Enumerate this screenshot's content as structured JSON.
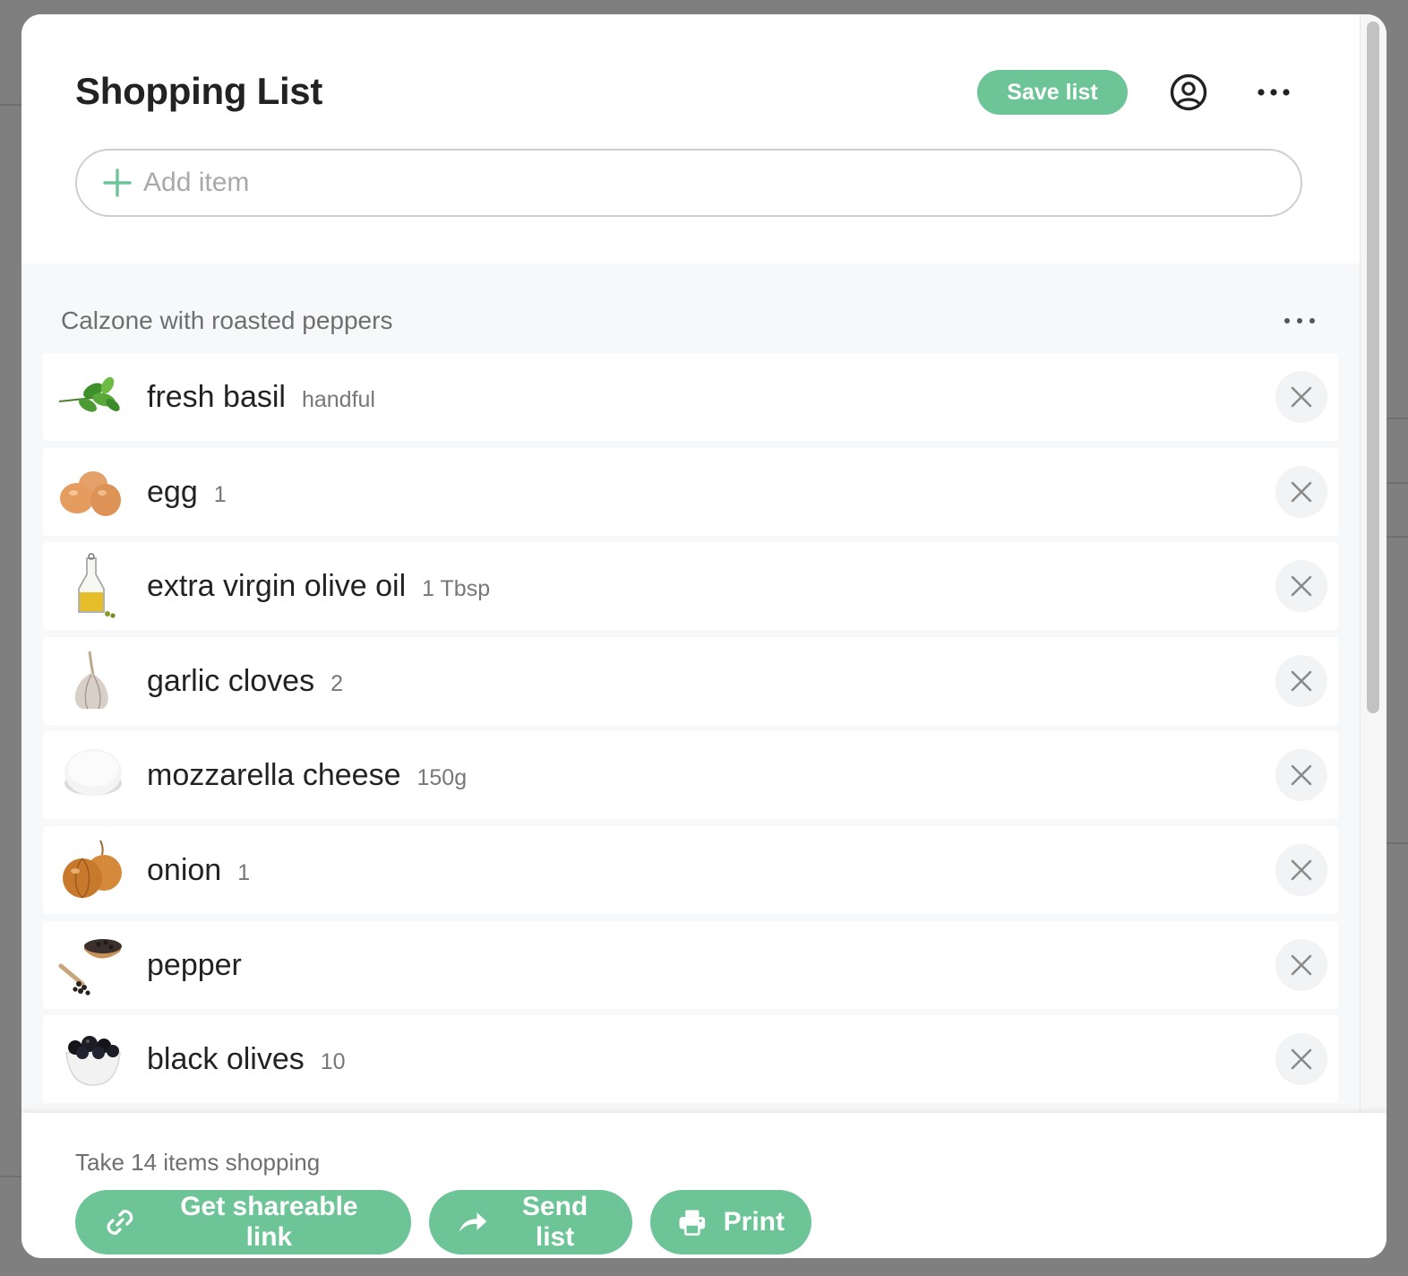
{
  "header": {
    "title": "Shopping List",
    "save_label": "Save list",
    "account_icon": "account-circle-icon",
    "more_icon": "more-horizontal-icon"
  },
  "add_item": {
    "placeholder": "Add item",
    "icon": "plus-icon"
  },
  "section": {
    "title": "Calzone with roasted peppers",
    "more_icon": "more-horizontal-icon"
  },
  "items": [
    {
      "name": "fresh basil",
      "qty": "handful",
      "icon": "basil-icon"
    },
    {
      "name": "egg",
      "qty": "1",
      "icon": "egg-icon"
    },
    {
      "name": "extra virgin olive oil",
      "qty": "1 Tbsp",
      "icon": "olive-oil-icon"
    },
    {
      "name": "garlic cloves",
      "qty": "2",
      "icon": "garlic-icon"
    },
    {
      "name": "mozzarella cheese",
      "qty": "150g",
      "icon": "mozzarella-icon"
    },
    {
      "name": "onion",
      "qty": "1",
      "icon": "onion-icon"
    },
    {
      "name": "pepper",
      "qty": "",
      "icon": "peppercorn-icon"
    },
    {
      "name": "black olives",
      "qty": "10",
      "icon": "black-olives-icon"
    }
  ],
  "footer": {
    "summary": "Take 14 items shopping",
    "share_label": "Get shareable link",
    "send_label": "Send list",
    "print_label": "Print"
  },
  "colors": {
    "accent": "#6cc497",
    "title_text": "#222222",
    "muted_text": "#6f6f6f"
  }
}
